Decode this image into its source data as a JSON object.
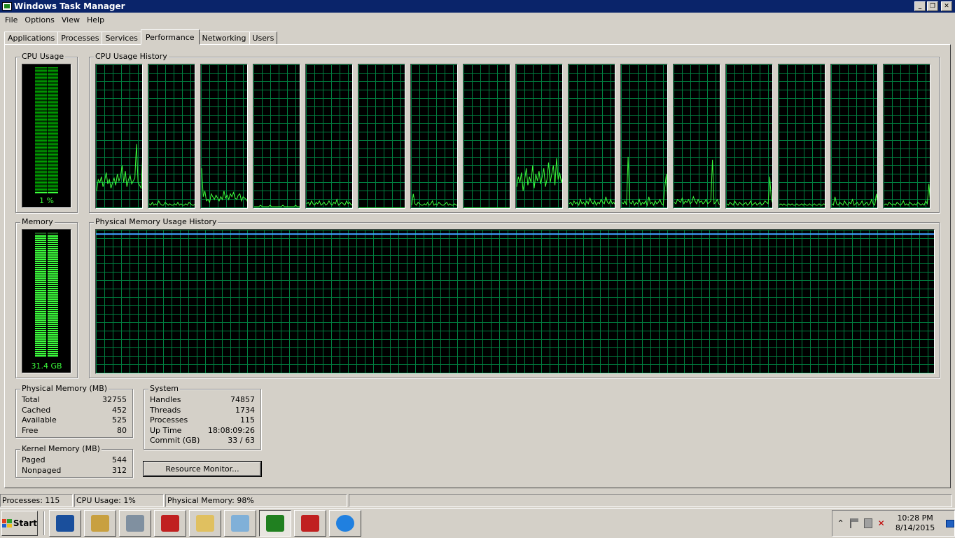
{
  "window": {
    "title": "Windows Task Manager",
    "buttons": [
      "_",
      "❐",
      "✕"
    ]
  },
  "menu": [
    "File",
    "Options",
    "View",
    "Help"
  ],
  "tabs": [
    "Applications",
    "Processes",
    "Services",
    "Performance",
    "Networking",
    "Users"
  ],
  "active_tab": "Performance",
  "cpu_usage": {
    "title": "CPU Usage",
    "value_label": "1 %",
    "percent": 1
  },
  "cpu_history": {
    "title": "CPU Usage History",
    "cores": [
      [
        12,
        20,
        18,
        22,
        15,
        19,
        25,
        17,
        20,
        14,
        18,
        21,
        16,
        24,
        19,
        22,
        30,
        18,
        26,
        15,
        20,
        23,
        17,
        19,
        21,
        45,
        18,
        16,
        14,
        40
      ],
      [
        3,
        2,
        4,
        2,
        3,
        2,
        5,
        3,
        2,
        2,
        4,
        3,
        2,
        3,
        2,
        2,
        3,
        2,
        4,
        2,
        3,
        2,
        2,
        3,
        2,
        4,
        3,
        2,
        2,
        3
      ],
      [
        28,
        8,
        12,
        5,
        6,
        4,
        10,
        8,
        6,
        9,
        7,
        5,
        8,
        6,
        12,
        7,
        9,
        6,
        10,
        8,
        11,
        7,
        6,
        9,
        10,
        5,
        8,
        7,
        6,
        4
      ],
      [
        1,
        1,
        1,
        1,
        2,
        1,
        1,
        1,
        1,
        1,
        2,
        1,
        1,
        1,
        1,
        1,
        1,
        1,
        2,
        1,
        1,
        1,
        1,
        1,
        1,
        1,
        2,
        1,
        1,
        1
      ],
      [
        3,
        4,
        2,
        5,
        3,
        2,
        4,
        3,
        5,
        2,
        3,
        4,
        2,
        3,
        5,
        3,
        2,
        4,
        3,
        6,
        2,
        3,
        4,
        3,
        2,
        5,
        3,
        4,
        2,
        3
      ],
      [
        0,
        0,
        0,
        0,
        0,
        0,
        0,
        0,
        0,
        0,
        0,
        0,
        0,
        0,
        0,
        0,
        0,
        0,
        0,
        0,
        0,
        0,
        0,
        0,
        0,
        0,
        0,
        0,
        0,
        0
      ],
      [
        2,
        10,
        3,
        2,
        4,
        3,
        2,
        2,
        3,
        2,
        4,
        2,
        3,
        5,
        2,
        3,
        2,
        4,
        3,
        2,
        2,
        3,
        4,
        2,
        3,
        2,
        2,
        3,
        2,
        2
      ],
      [
        0,
        0,
        0,
        0,
        0,
        0,
        0,
        0,
        0,
        0,
        0,
        0,
        0,
        0,
        0,
        0,
        0,
        0,
        0,
        0,
        0,
        0,
        0,
        0,
        0,
        0,
        0,
        0,
        0,
        0
      ],
      [
        15,
        22,
        18,
        25,
        12,
        20,
        28,
        16,
        22,
        18,
        30,
        14,
        24,
        19,
        26,
        17,
        22,
        28,
        15,
        20,
        32,
        18,
        24,
        30,
        16,
        35,
        20,
        25,
        18,
        22
      ],
      [
        3,
        4,
        2,
        5,
        3,
        4,
        2,
        6,
        3,
        4,
        2,
        5,
        3,
        7,
        4,
        3,
        5,
        2,
        4,
        3,
        6,
        4,
        3,
        8,
        4,
        3,
        6,
        3,
        4,
        2
      ],
      [
        4,
        3,
        5,
        2,
        36,
        4,
        3,
        5,
        2,
        4,
        3,
        6,
        2,
        4,
        3,
        5,
        2,
        8,
        3,
        4,
        2,
        5,
        3,
        4,
        6,
        3,
        2,
        14,
        24,
        3
      ],
      [
        4,
        3,
        6,
        5,
        4,
        7,
        3,
        5,
        4,
        6,
        3,
        4,
        8,
        5,
        3,
        6,
        4,
        5,
        3,
        4,
        6,
        3,
        4,
        5,
        34,
        3,
        4,
        6,
        3,
        2
      ],
      [
        3,
        2,
        4,
        3,
        2,
        5,
        3,
        2,
        4,
        3,
        2,
        3,
        4,
        2,
        3,
        5,
        2,
        3,
        4,
        2,
        3,
        4,
        2,
        3,
        5,
        4,
        3,
        22,
        6,
        3
      ],
      [
        2,
        3,
        2,
        3,
        2,
        2,
        3,
        2,
        3,
        2,
        2,
        3,
        2,
        2,
        3,
        2,
        3,
        2,
        2,
        3,
        2,
        2,
        3,
        2,
        2,
        3,
        2,
        2,
        3,
        2
      ],
      [
        3,
        2,
        8,
        3,
        2,
        4,
        3,
        2,
        5,
        3,
        2,
        4,
        3,
        6,
        2,
        3,
        4,
        2,
        3,
        5,
        2,
        3,
        4,
        2,
        3,
        6,
        3,
        2,
        10,
        3
      ],
      [
        2,
        3,
        2,
        4,
        3,
        2,
        3,
        2,
        4,
        3,
        2,
        3,
        5,
        2,
        3,
        2,
        4,
        3,
        2,
        3,
        2,
        4,
        3,
        2,
        3,
        2,
        5,
        3,
        17,
        3
      ]
    ]
  },
  "memory": {
    "title": "Memory",
    "value_label": "31.4 GB",
    "percent": 98
  },
  "memory_history": {
    "title": "Physical Memory Usage History",
    "percent": 98
  },
  "physical_memory": {
    "title": "Physical Memory (MB)",
    "rows": [
      {
        "label": "Total",
        "value": "32755"
      },
      {
        "label": "Cached",
        "value": "452"
      },
      {
        "label": "Available",
        "value": "525"
      },
      {
        "label": "Free",
        "value": "80"
      }
    ]
  },
  "kernel_memory": {
    "title": "Kernel Memory (MB)",
    "rows": [
      {
        "label": "Paged",
        "value": "544"
      },
      {
        "label": "Nonpaged",
        "value": "312"
      }
    ]
  },
  "system": {
    "title": "System",
    "rows": [
      {
        "label": "Handles",
        "value": "74857"
      },
      {
        "label": "Threads",
        "value": "1734"
      },
      {
        "label": "Processes",
        "value": "115"
      },
      {
        "label": "Up Time",
        "value": "18:08:09:26"
      },
      {
        "label": "Commit (GB)",
        "value": "33 / 63"
      }
    ]
  },
  "resource_monitor_label": "Resource Monitor...",
  "statusbar": {
    "processes": "Processes: 115",
    "cpu": "CPU Usage: 1%",
    "memory": "Physical Memory: 98%"
  },
  "taskbar": {
    "start_label": "Start",
    "apps": [
      {
        "name": "powershell-icon",
        "color": "#1a4f9c"
      },
      {
        "name": "server-manager-icon",
        "color": "#c8a040"
      },
      {
        "name": "computer-management-icon",
        "color": "#8090a0"
      },
      {
        "name": "toolbox-icon",
        "color": "#c02020"
      },
      {
        "name": "folder-icon",
        "color": "#e0c060"
      },
      {
        "name": "notepad-icon",
        "color": "#80b0d8"
      },
      {
        "name": "task-manager-icon",
        "color": "#208020"
      },
      {
        "name": "toolbox-icon",
        "color": "#c02020"
      },
      {
        "name": "internet-explorer-icon",
        "color": "#2080e0"
      }
    ],
    "clock_time": "10:28 PM",
    "clock_date": "8/14/2015"
  },
  "colors": {
    "graph_line": "#3cff3c",
    "grid": "#008040",
    "memory_line": "#3fa0ff",
    "title_bar": "#0a246a"
  }
}
